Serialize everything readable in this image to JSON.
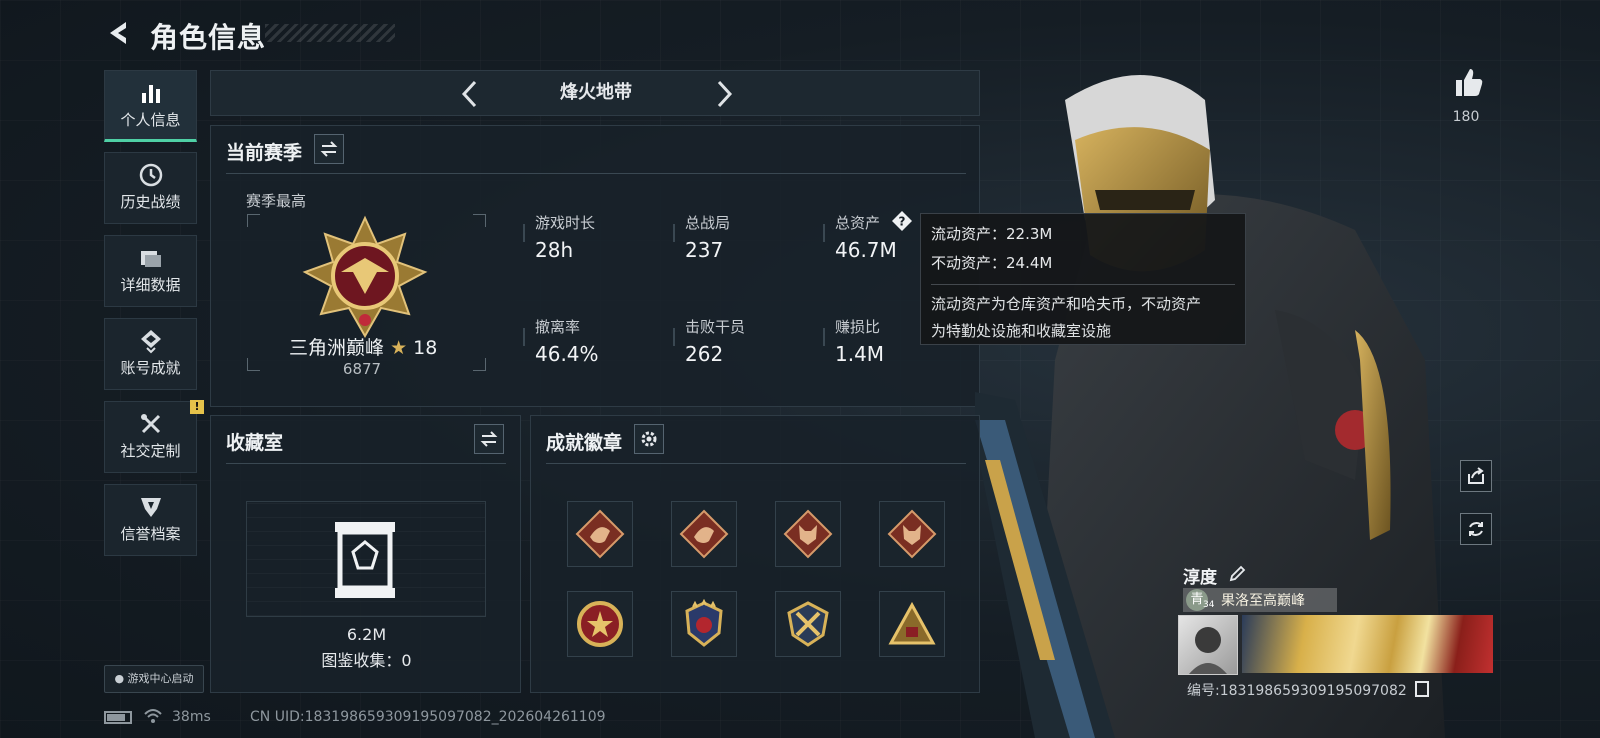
{
  "header": {
    "title": "角色信息"
  },
  "sidebar": {
    "items": [
      {
        "label": "个人信息",
        "icon": "bar-chart-icon",
        "active": true
      },
      {
        "label": "历史战绩",
        "icon": "clock-icon"
      },
      {
        "label": "详细数据",
        "icon": "folder-icon"
      },
      {
        "label": "账号成就",
        "icon": "achievement-icon"
      },
      {
        "label": "社交定制",
        "icon": "tools-icon",
        "badge": "!"
      },
      {
        "label": "信誉档案",
        "icon": "shield-icon"
      }
    ],
    "game_center": "游戏中心启动"
  },
  "mode": {
    "name": "烽火地带"
  },
  "season": {
    "title": "当前赛季",
    "best_label": "赛季最高",
    "rank_name": "三角洲巅峰",
    "rank_stars": "18",
    "rank_score": "6877",
    "stats": [
      {
        "label": "游戏时长",
        "value": "28h"
      },
      {
        "label": "总战局",
        "value": "237"
      },
      {
        "label": "总资产",
        "value": "46.7M"
      },
      {
        "label": "撤离率",
        "value": "46.4%"
      },
      {
        "label": "击败干员",
        "value": "262"
      },
      {
        "label": "赚损比",
        "value": "1.4M"
      }
    ]
  },
  "tooltip": {
    "liquid": "流动资产：22.3M",
    "fixed": "不动资产：24.4M",
    "desc_line1": "流动资产为仓库资产和哈夫币，不动资产",
    "desc_line2": "为特勤处设施和收藏室设施"
  },
  "collection": {
    "title": "收藏室",
    "value": "6.2M",
    "catalog": "图鉴收集：0"
  },
  "achievements": {
    "title": "成就徽章",
    "badges": [
      "dragon-badge-icon",
      "dragon-badge-icon",
      "wolf-badge-icon",
      "wolf-badge-icon",
      "star-emblem-icon",
      "star-wing-emblem-icon",
      "crossed-swords-emblem-icon",
      "pyramid-badge-icon"
    ]
  },
  "player": {
    "likes": "180",
    "name": "淳度",
    "title_level": "34",
    "title_text": "果洛至高巅峰",
    "title_glyph": "青",
    "id_text": "编号:18319865930919509708​2"
  },
  "footer": {
    "ping": "38ms",
    "uid": "CN UID:183198659309195097082_202604261109"
  },
  "colors": {
    "accent": "#4fd0a5",
    "warning": "#e5c24a",
    "gold": "#c9a24a"
  }
}
